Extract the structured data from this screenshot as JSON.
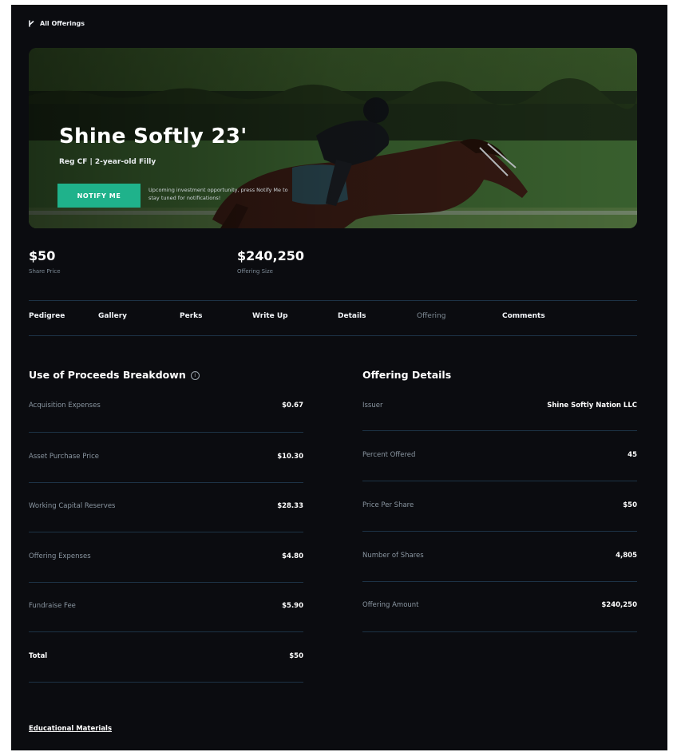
{
  "nav": {
    "back_label": "All Offerings"
  },
  "hero": {
    "title": "Shine Softly 23'",
    "subtitle": "Reg CF | 2-year-old Filly",
    "notify_label": "NOTIFY ME",
    "note": "Upcoming investment opportunity, press Notify Me to stay tuned for notifications!"
  },
  "stats": [
    {
      "value": "$50",
      "label": "Share Price"
    },
    {
      "value": "$240,250",
      "label": "Offering Size"
    }
  ],
  "tabs": [
    {
      "label": "Pedigree"
    },
    {
      "label": "Gallery"
    },
    {
      "label": "Perks"
    },
    {
      "label": "Write Up"
    },
    {
      "label": "Details"
    },
    {
      "label": "Offering"
    },
    {
      "label": "Comments"
    }
  ],
  "proceeds": {
    "title": "Use of Proceeds Breakdown",
    "rows": [
      {
        "key": "Acquisition Expenses",
        "value": "$0.67"
      },
      {
        "key": "Asset Purchase Price",
        "value": "$10.30"
      },
      {
        "key": "Working Capital Reserves",
        "value": "$28.33"
      },
      {
        "key": "Offering Expenses",
        "value": "$4.80"
      },
      {
        "key": "Fundraise Fee",
        "value": "$5.90"
      },
      {
        "key": "Total",
        "value": "$50"
      }
    ]
  },
  "details": {
    "title": "Offering Details",
    "rows": [
      {
        "key": "Issuer",
        "value": "Shine Softly Nation LLC"
      },
      {
        "key": "Percent Offered",
        "value": "45"
      },
      {
        "key": "Price Per Share",
        "value": "$50"
      },
      {
        "key": "Number of Shares",
        "value": "4,805"
      },
      {
        "key": "Offering Amount",
        "value": "$240,250"
      }
    ]
  },
  "footer": {
    "edu_label": "Educational Materials"
  },
  "colors": {
    "page_bg": "#0b0c10",
    "accent": "#1fb28b",
    "divider": "#1d3346"
  }
}
